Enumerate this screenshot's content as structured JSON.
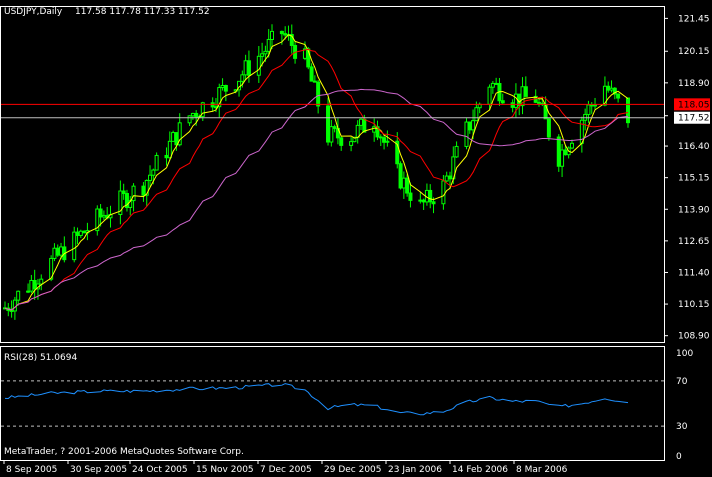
{
  "header": {
    "symbol_label": "USDJPY,Daily",
    "ohlc_label": "117.58 117.78 117.33 117.52"
  },
  "rsi_panel": {
    "label": "RSI(28) 51.0694",
    "copyright": "MetaTrader, ? 2001-2006 MetaQuotes Software Corp."
  },
  "colors": {
    "background": "#000000",
    "axis": "#ffffff",
    "candle": "#00ff00",
    "ma_fast": "#ffff00",
    "ma_mid": "#ff0000",
    "ma_slow": "#cc66cc",
    "rsi_line": "#1e90ff",
    "price_line": "#ff0000",
    "bid_line": "#c0c0c0",
    "level_line": "#c0c0c0",
    "price_tag_bg": "#ff0000",
    "bid_tag_bg": "#ffffff"
  },
  "chart_data": [
    {
      "type": "line",
      "title": "USDJPY,Daily",
      "y_ticks": [
        "121.45",
        "120.15",
        "118.90",
        "117.60",
        "116.40",
        "115.15",
        "113.90",
        "112.65",
        "111.40",
        "110.15",
        "108.90"
      ],
      "ylim": [
        108.65,
        121.9
      ],
      "x_ticks": [
        "8 Sep 2005",
        "30 Sep 2005",
        "24 Oct 2005",
        "15 Nov 2005",
        "7 Dec 2005",
        "29 Dec 2005",
        "23 Jan 2006",
        "14 Feb 2006",
        "8 Mar 2006"
      ],
      "price_marker": "118.05",
      "bid_marker": "117.52",
      "series": [
        {
          "name": "close",
          "x": [
            "2005-09-05",
            "2005-09-19",
            "2005-10-03",
            "2005-10-17",
            "2005-10-31",
            "2005-11-14",
            "2005-11-28",
            "2005-12-05",
            "2005-12-12",
            "2005-12-19",
            "2005-12-26",
            "2006-01-02",
            "2006-01-09",
            "2006-01-16",
            "2006-01-23",
            "2006-01-30",
            "2006-02-06",
            "2006-02-13",
            "2006-02-20",
            "2006-02-27",
            "2006-03-06",
            "2006-03-13"
          ],
          "values": [
            110.0,
            111.8,
            113.5,
            114.9,
            117.6,
            119.0,
            120.9,
            119.8,
            116.8,
            116.8,
            117.5,
            115.3,
            114.0,
            114.8,
            117.0,
            118.9,
            118.3,
            118.3,
            116.0,
            117.5,
            118.8,
            117.52
          ]
        }
      ]
    },
    {
      "type": "line",
      "title": "RSI(28) 51.0694",
      "y_ticks": [
        "100",
        "70",
        "30",
        "0"
      ],
      "ylim": [
        0,
        100
      ],
      "levels": [
        70,
        30
      ],
      "series": [
        {
          "name": "RSI(28)",
          "x": [
            "2005-09-05",
            "2005-09-19",
            "2005-10-03",
            "2005-10-17",
            "2005-10-31",
            "2005-11-14",
            "2005-11-28",
            "2005-12-05",
            "2005-12-12",
            "2005-12-19",
            "2005-12-26",
            "2006-01-02",
            "2006-01-09",
            "2006-01-16",
            "2006-01-23",
            "2006-01-30",
            "2006-02-06",
            "2006-02-13",
            "2006-02-20",
            "2006-02-27",
            "2006-03-06",
            "2006-03-13"
          ],
          "values": [
            55,
            59,
            61,
            61,
            63,
            64,
            67,
            62,
            46,
            49,
            48,
            42,
            41,
            43,
            51,
            55,
            52,
            52,
            47,
            50,
            55,
            51.07
          ]
        }
      ]
    }
  ]
}
